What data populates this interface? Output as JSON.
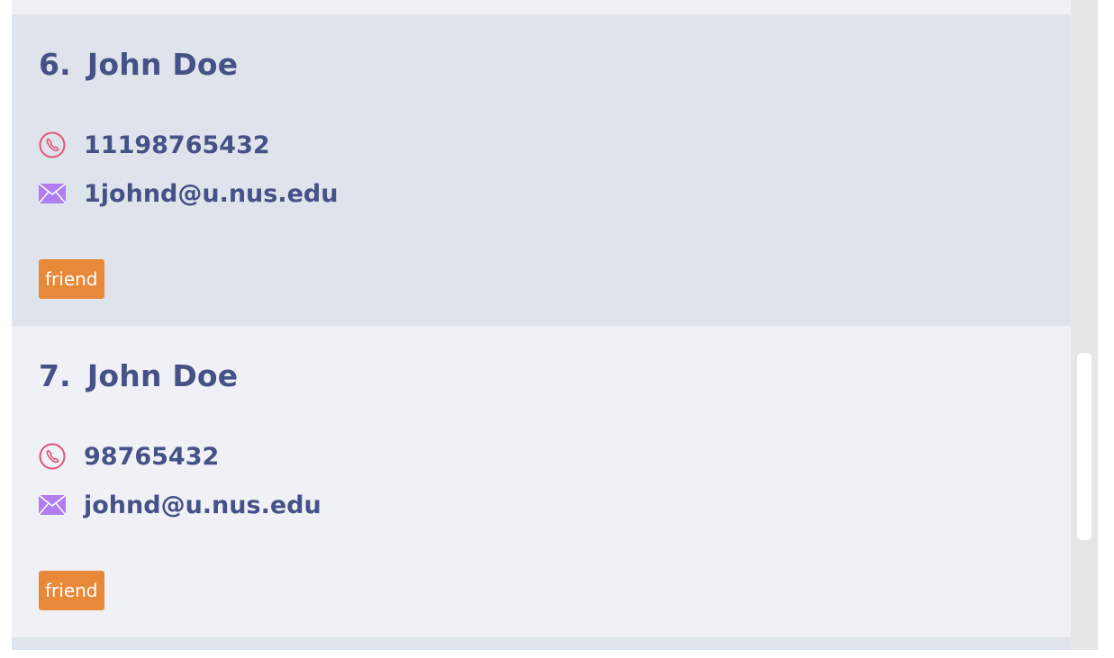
{
  "contacts": [
    {
      "index": "6.",
      "name": "John Doe",
      "phone": "11198765432",
      "email": "1johnd@u.nus.edu",
      "tags": [
        "friend"
      ]
    },
    {
      "index": "7.",
      "name": "John Doe",
      "phone": "98765432",
      "email": "johnd@u.nus.edu",
      "tags": [
        "friend"
      ]
    }
  ],
  "icons": {
    "phone": "phone-icon",
    "email": "envelope-icon"
  },
  "colors": {
    "card_alt_bg": "#dfe3eb",
    "card_bg": "#eff1f6",
    "text": "#465287",
    "phone_icon": "#e0577b",
    "email_icon": "#b07ef0",
    "tag_bg": "#e8893a"
  }
}
